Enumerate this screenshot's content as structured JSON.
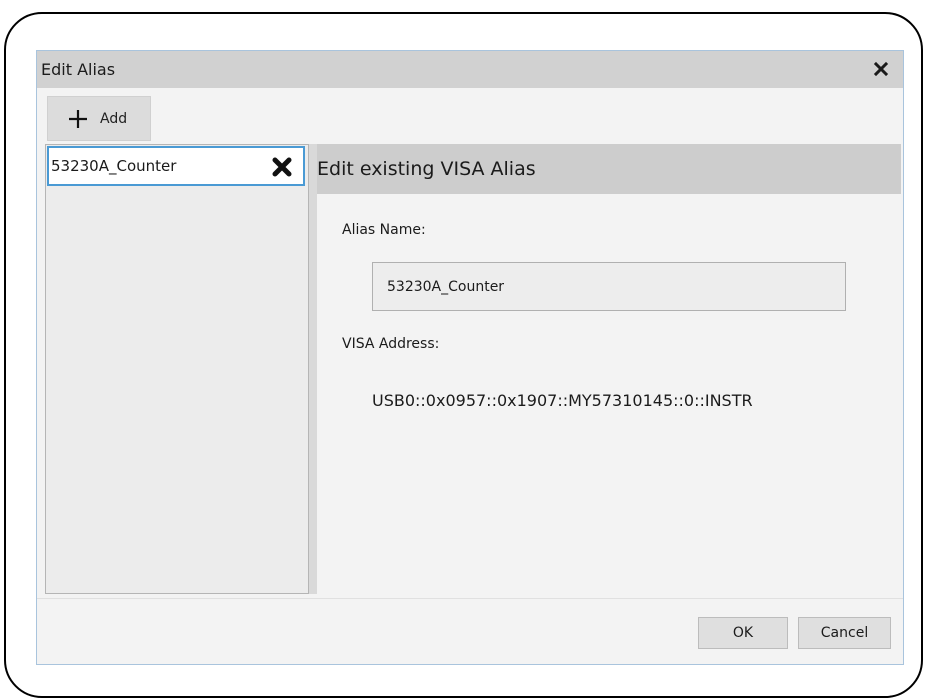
{
  "dialog": {
    "title": "Edit Alias",
    "close_icon": "close-icon"
  },
  "toolbar": {
    "add_label": "Add",
    "add_icon": "plus-icon"
  },
  "alias_list": {
    "items": [
      {
        "label": "53230A_Counter",
        "selected": true,
        "delete_icon": "delete-icon"
      }
    ]
  },
  "details": {
    "header": "Edit existing VISA Alias",
    "alias_name_label": "Alias Name:",
    "alias_name_value": "53230A_Counter",
    "visa_address_label": "VISA Address:",
    "visa_address_value": "USB0::0x0957::0x1907::MY57310145::0::INSTR"
  },
  "footer": {
    "ok_label": "OK",
    "cancel_label": "Cancel"
  },
  "colors": {
    "selection_border": "#4a9ad4",
    "titlebar": "#d1d1d1",
    "dialog_border": "#a9c4dd"
  }
}
